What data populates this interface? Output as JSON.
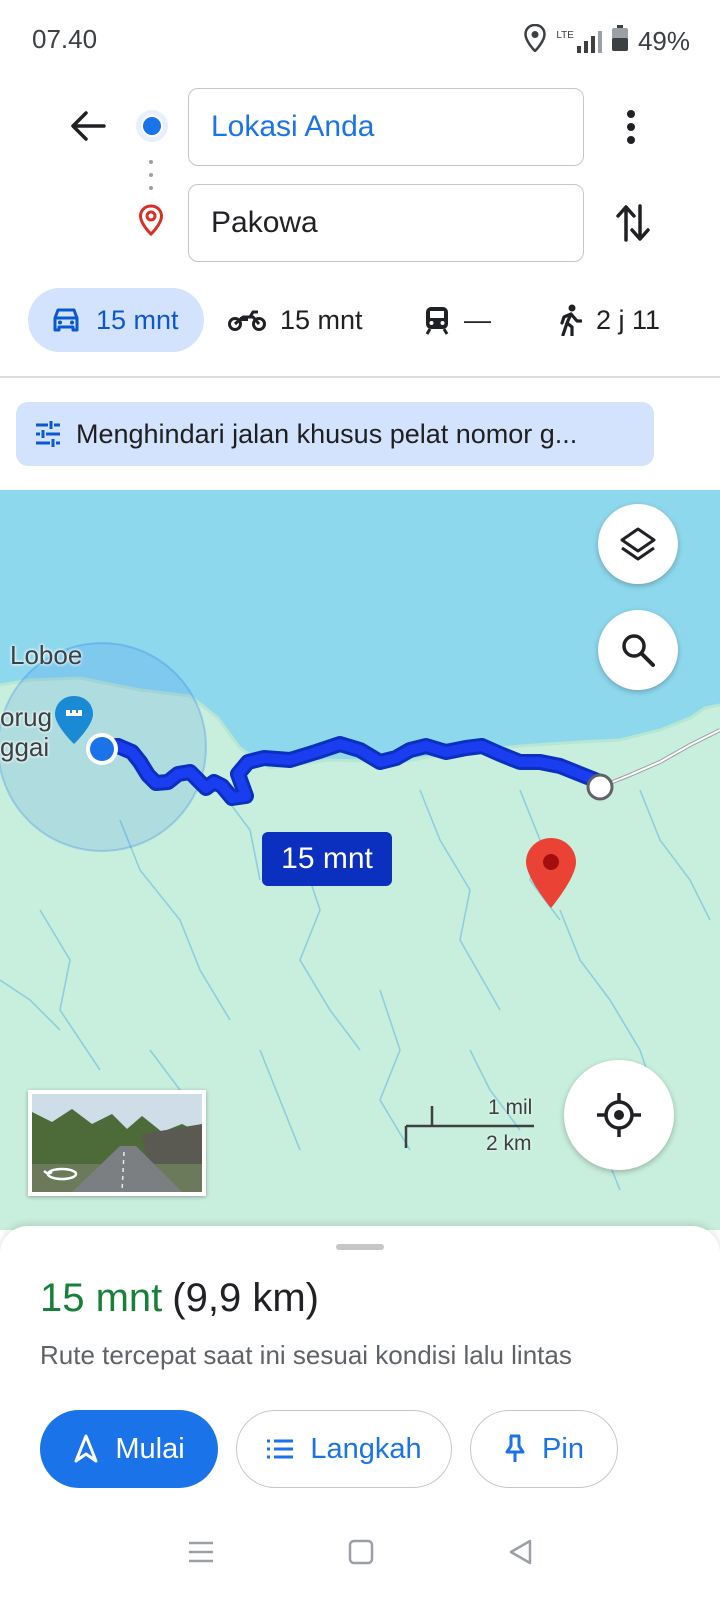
{
  "status_bar": {
    "time": "07.40",
    "network_label": "LTE",
    "battery": "49%",
    "icons": [
      "location-icon",
      "signal-icon",
      "battery-icon"
    ]
  },
  "directions": {
    "origin": "Lokasi Anda",
    "destination": "Pakowa"
  },
  "modes": [
    {
      "name": "car",
      "icon": "car-icon",
      "label": "15 mnt",
      "active": true
    },
    {
      "name": "motorcycle",
      "icon": "motorcycle-icon",
      "label": "15 mnt",
      "active": false
    },
    {
      "name": "transit",
      "icon": "train-icon",
      "label": "—",
      "active": false
    },
    {
      "name": "walk",
      "icon": "walking-icon",
      "label": "2 j 11",
      "active": false
    }
  ],
  "avoid_chip": {
    "icon": "tune-icon",
    "label": "Menghindari jalan khusus pelat nomor g..."
  },
  "map": {
    "place_labels": {
      "loboe": "Loboe",
      "poi_line1": "orug",
      "poi_line2": "ggai"
    },
    "route_badge": "15 mnt",
    "scale": {
      "imperial": "1 mil",
      "metric": "2 km"
    },
    "colors": {
      "water": "#8ed8ee",
      "land": "#c8eedd",
      "route": "#1a3df0",
      "pin": "#ea4335"
    }
  },
  "sheet": {
    "eta_time": "15 mnt",
    "eta_distance": "(9,9 km)",
    "description": "Rute tercepat saat ini sesuai kondisi lalu lintas",
    "buttons": {
      "start": "Mulai",
      "steps": "Langkah",
      "pin": "Pin"
    }
  },
  "colors": {
    "accent": "#1a73e8",
    "eta_green": "#188038",
    "chip_bg": "#d3e3fd"
  }
}
